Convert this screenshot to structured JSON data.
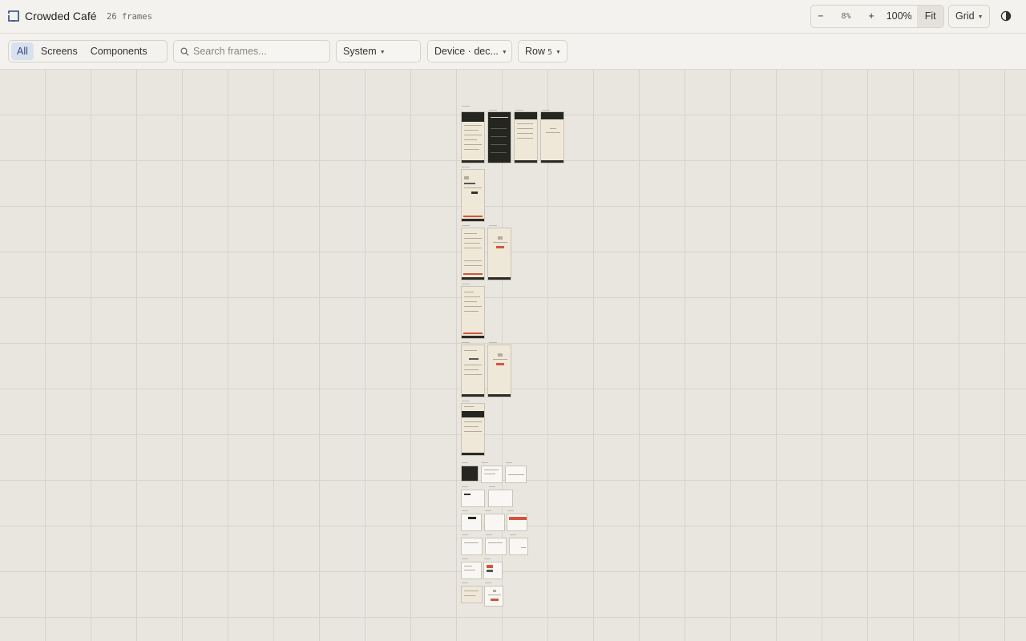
{
  "app": {
    "title": "Crowded Café",
    "frame_count": "26 frames"
  },
  "zoom": {
    "minus_label": "−",
    "value": "8%",
    "plus_label": "+",
    "hundred_label": "100%",
    "fit_label": "Fit"
  },
  "layout_dropdown": {
    "label": "Grid"
  },
  "filters": {
    "tabs": [
      {
        "label": "All",
        "active": true
      },
      {
        "label": "Screens",
        "active": false
      },
      {
        "label": "Components",
        "active": false
      }
    ]
  },
  "search": {
    "placeholder": "Search frames...",
    "value": ""
  },
  "theme_dropdown": {
    "label": "System"
  },
  "device_dropdown": {
    "label": "Device · dec..."
  },
  "row_dropdown": {
    "label": "Row",
    "value": "5"
  },
  "icons": {
    "logo": "frame-logo-icon",
    "search": "search-icon",
    "theme": "contrast-icon",
    "caret": "chevron-down-icon"
  },
  "colors": {
    "accent_blue": "#2c4a86",
    "active_tab_bg": "#d9e0ee",
    "frame_cream": "#efe8d8",
    "frame_dark": "#25261f",
    "cta_orange": "#d4553a"
  }
}
